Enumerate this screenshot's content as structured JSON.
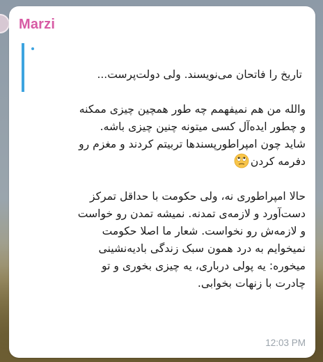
{
  "message": {
    "sender": "Marzi",
    "quote": "تاریخ را فاتحان می‌نویسند. ولی دولت‌پرست...",
    "paragraph1": [
      "والله من هم نمیفهمم چه طور همچین چیزی ممکنه",
      "و چطور ایده‌آل کسی میتونه چنین چیزی باشه.",
      "شاید چون امپراطورپسندها تربیتم کردند و مغزم رو",
      "دفرمه کردن"
    ],
    "emoji": "🙄",
    "paragraph2": [
      "حالا امپراطوری نه، ولی حکومت با حداقل تمرکز",
      "دست‌آورد و لازمه‌ی تمدنه. نمیشه تمدن رو خواست",
      "و لازمه‌ش رو نخواست. شعار ما اصلا حکومت",
      "نمیخوایم به درد همون سبک زندگی بادیه‌نشینی",
      "میخوره: یه پولی درباری، یه چیزی بخوری و تو",
      "چادرت با زنهات بخوابی."
    ],
    "time": "12:03 PM"
  },
  "colors": {
    "sender": "#d75ba4",
    "quote_bar": "#3da4e0",
    "bubble": "#ffffff",
    "time": "#9aa3ab"
  },
  "icons": {
    "emoji": "face-with-rolling-eyes-icon"
  }
}
